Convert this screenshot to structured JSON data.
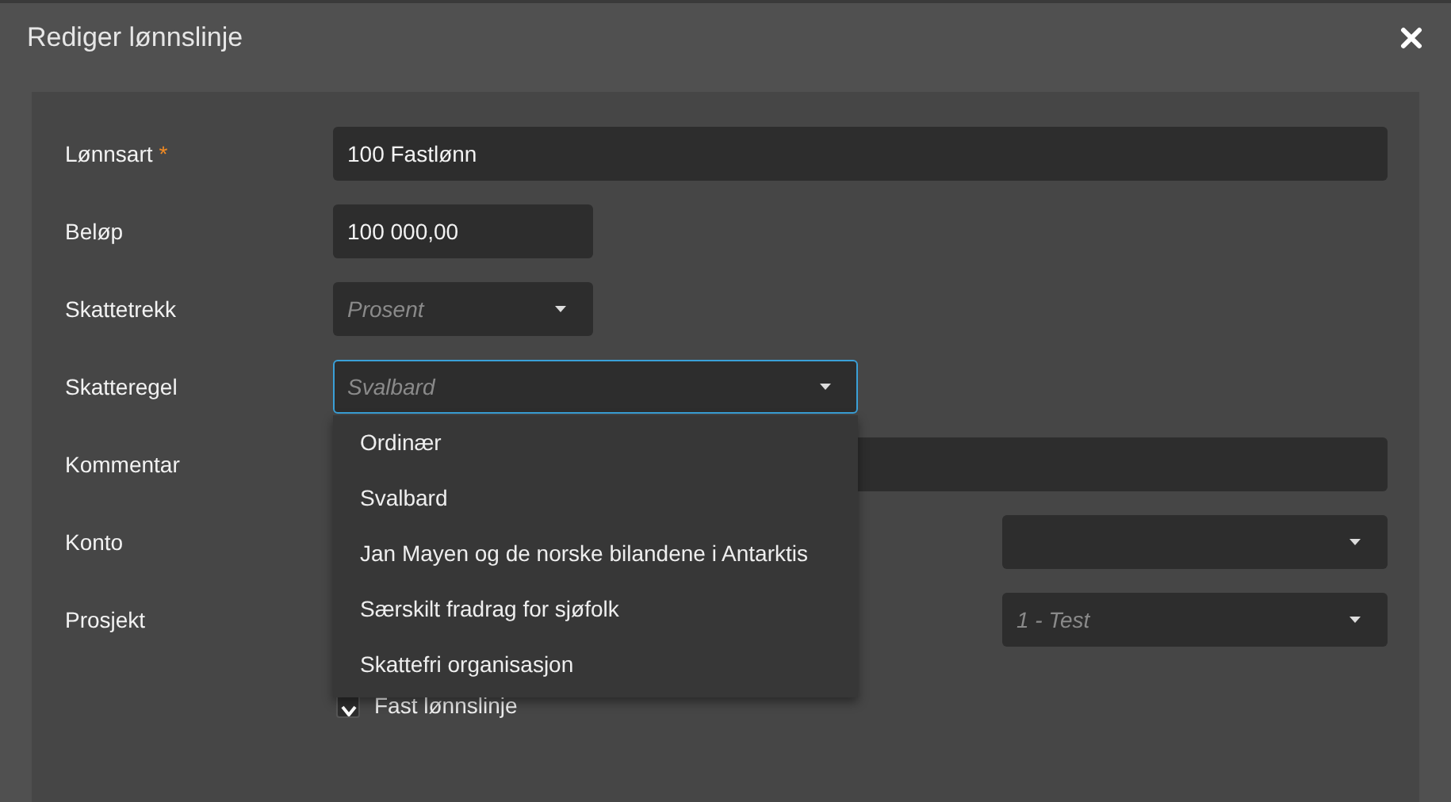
{
  "dialog": {
    "title": "Rediger lønnslinje"
  },
  "fields": [
    {
      "label": "Lønnsart",
      "required_mark": "*",
      "kind": "text",
      "value": "100 Fastlønn"
    },
    {
      "label": "Beløp",
      "kind": "text",
      "value": "100 000,00"
    },
    {
      "label": "Skattetrekk",
      "kind": "select",
      "placeholder": "Prosent",
      "focused": false
    },
    {
      "label": "Skatteregel",
      "kind": "select",
      "placeholder": "Svalbard",
      "focused": true,
      "expanded": true,
      "options": [
        "Ordinær",
        "Svalbard",
        "Jan Mayen og de norske bilandene i Antarktis",
        "Særskilt fradrag for sjøfolk",
        "Skattefri organisasjon"
      ]
    },
    {
      "label": "Kommentar",
      "kind": "text"
    },
    {
      "label": "Konto",
      "kind": "select",
      "focused": false
    },
    {
      "label": "Prosjekt",
      "kind": "select",
      "placeholder": "1 - Test",
      "focused": false
    }
  ],
  "checkbox": {
    "label": "Fast lønnslinje",
    "checked": true
  }
}
